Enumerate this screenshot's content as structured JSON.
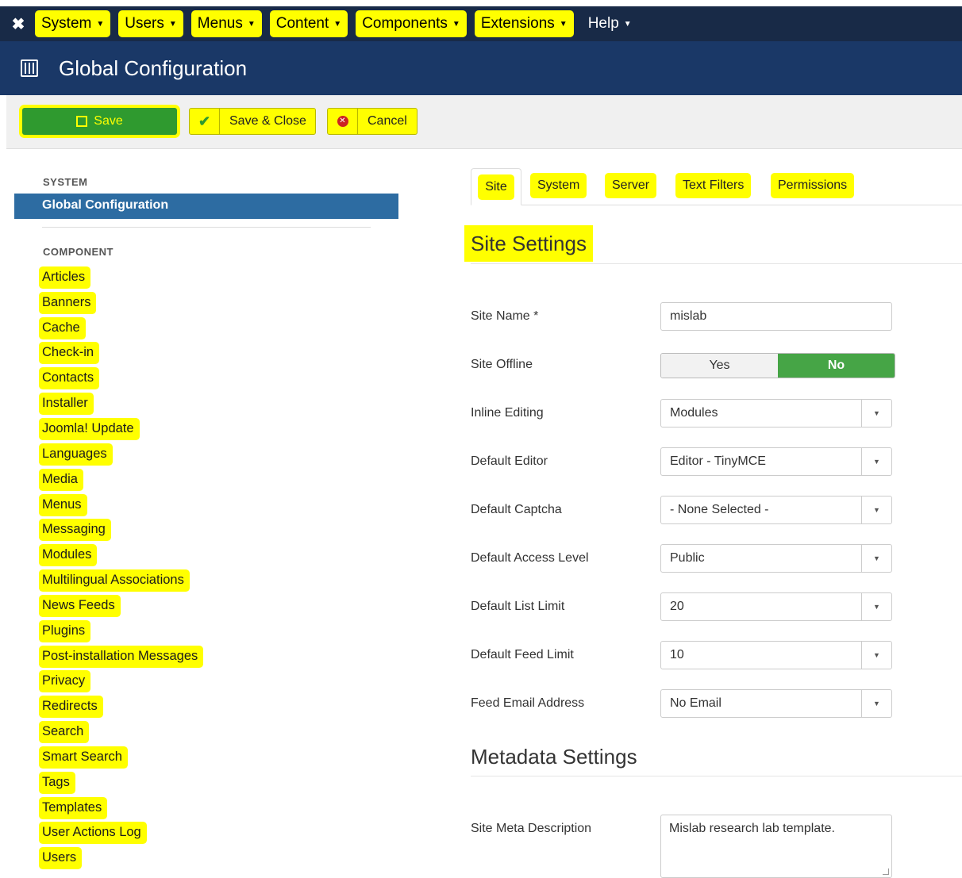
{
  "topnav": {
    "items": [
      {
        "label": "System",
        "highlighted": true
      },
      {
        "label": "Users",
        "highlighted": true
      },
      {
        "label": "Menus",
        "highlighted": true
      },
      {
        "label": "Content",
        "highlighted": true
      },
      {
        "label": "Components",
        "highlighted": true
      },
      {
        "label": "Extensions",
        "highlighted": true
      },
      {
        "label": "Help",
        "highlighted": false
      }
    ]
  },
  "header": {
    "title": "Global Configuration"
  },
  "toolbar": {
    "save": "Save",
    "save_close": "Save & Close",
    "cancel": "Cancel"
  },
  "sidebar": {
    "system_heading": "SYSTEM",
    "active_item": "Global Configuration",
    "component_heading": "COMPONENT",
    "items": [
      "Articles",
      "Banners",
      "Cache",
      "Check-in",
      "Contacts",
      "Installer",
      "Joomla! Update",
      "Languages",
      "Media",
      "Menus",
      "Messaging",
      "Modules",
      "Multilingual Associations",
      "News Feeds",
      "Plugins",
      "Post-installation Messages",
      "Privacy",
      "Redirects",
      "Search",
      "Smart Search",
      "Tags",
      "Templates",
      "User Actions Log",
      "Users"
    ]
  },
  "tabs": [
    "Site",
    "System",
    "Server",
    "Text Filters",
    "Permissions"
  ],
  "site_settings": {
    "heading": "Site Settings",
    "site_name_label": "Site Name *",
    "site_name_value": "mislab",
    "site_offline_label": "Site Offline",
    "site_offline_yes": "Yes",
    "site_offline_no": "No",
    "inline_editing_label": "Inline Editing",
    "inline_editing_value": "Modules",
    "default_editor_label": "Default Editor",
    "default_editor_value": "Editor - TinyMCE",
    "default_captcha_label": "Default Captcha",
    "default_captcha_value": "- None Selected -",
    "default_access_label": "Default Access Level",
    "default_access_value": "Public",
    "default_list_limit_label": "Default List Limit",
    "default_list_limit_value": "20",
    "default_feed_limit_label": "Default Feed Limit",
    "default_feed_limit_value": "10",
    "feed_email_label": "Feed Email Address",
    "feed_email_value": "No Email"
  },
  "metadata_settings": {
    "heading": "Metadata Settings",
    "site_meta_desc_label": "Site Meta Description",
    "site_meta_desc_value": "Mislab research lab template."
  },
  "colors": {
    "highlight": "#ffff00",
    "navbar": "#182a47",
    "titlebar": "#1a3867",
    "save_green": "#2f9a2f",
    "active_blue": "#2d6ca2",
    "toggle_no": "#46a546"
  }
}
